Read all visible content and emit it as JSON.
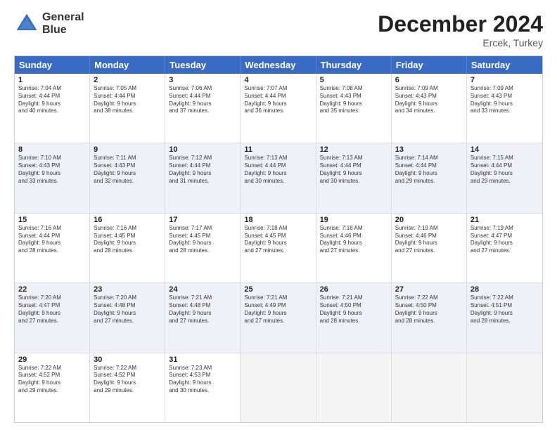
{
  "header": {
    "logo_line1": "General",
    "logo_line2": "Blue",
    "main_title": "December 2024",
    "subtitle": "Ercek, Turkey"
  },
  "weekdays": [
    "Sunday",
    "Monday",
    "Tuesday",
    "Wednesday",
    "Thursday",
    "Friday",
    "Saturday"
  ],
  "rows": [
    {
      "alt": false,
      "cells": [
        {
          "day": "1",
          "lines": [
            "Sunrise: 7:04 AM",
            "Sunset: 4:44 PM",
            "Daylight: 9 hours",
            "and 40 minutes."
          ]
        },
        {
          "day": "2",
          "lines": [
            "Sunrise: 7:05 AM",
            "Sunset: 4:44 PM",
            "Daylight: 9 hours",
            "and 38 minutes."
          ]
        },
        {
          "day": "3",
          "lines": [
            "Sunrise: 7:06 AM",
            "Sunset: 4:44 PM",
            "Daylight: 9 hours",
            "and 37 minutes."
          ]
        },
        {
          "day": "4",
          "lines": [
            "Sunrise: 7:07 AM",
            "Sunset: 4:44 PM",
            "Daylight: 9 hours",
            "and 36 minutes."
          ]
        },
        {
          "day": "5",
          "lines": [
            "Sunrise: 7:08 AM",
            "Sunset: 4:43 PM",
            "Daylight: 9 hours",
            "and 35 minutes."
          ]
        },
        {
          "day": "6",
          "lines": [
            "Sunrise: 7:09 AM",
            "Sunset: 4:43 PM",
            "Daylight: 9 hours",
            "and 34 minutes."
          ]
        },
        {
          "day": "7",
          "lines": [
            "Sunrise: 7:09 AM",
            "Sunset: 4:43 PM",
            "Daylight: 9 hours",
            "and 33 minutes."
          ]
        }
      ]
    },
    {
      "alt": true,
      "cells": [
        {
          "day": "8",
          "lines": [
            "Sunrise: 7:10 AM",
            "Sunset: 4:43 PM",
            "Daylight: 9 hours",
            "and 33 minutes."
          ]
        },
        {
          "day": "9",
          "lines": [
            "Sunrise: 7:11 AM",
            "Sunset: 4:43 PM",
            "Daylight: 9 hours",
            "and 32 minutes."
          ]
        },
        {
          "day": "10",
          "lines": [
            "Sunrise: 7:12 AM",
            "Sunset: 4:44 PM",
            "Daylight: 9 hours",
            "and 31 minutes."
          ]
        },
        {
          "day": "11",
          "lines": [
            "Sunrise: 7:13 AM",
            "Sunset: 4:44 PM",
            "Daylight: 9 hours",
            "and 30 minutes."
          ]
        },
        {
          "day": "12",
          "lines": [
            "Sunrise: 7:13 AM",
            "Sunset: 4:44 PM",
            "Daylight: 9 hours",
            "and 30 minutes."
          ]
        },
        {
          "day": "13",
          "lines": [
            "Sunrise: 7:14 AM",
            "Sunset: 4:44 PM",
            "Daylight: 9 hours",
            "and 29 minutes."
          ]
        },
        {
          "day": "14",
          "lines": [
            "Sunrise: 7:15 AM",
            "Sunset: 4:44 PM",
            "Daylight: 9 hours",
            "and 29 minutes."
          ]
        }
      ]
    },
    {
      "alt": false,
      "cells": [
        {
          "day": "15",
          "lines": [
            "Sunrise: 7:16 AM",
            "Sunset: 4:44 PM",
            "Daylight: 9 hours",
            "and 28 minutes."
          ]
        },
        {
          "day": "16",
          "lines": [
            "Sunrise: 7:16 AM",
            "Sunset: 4:45 PM",
            "Daylight: 9 hours",
            "and 28 minutes."
          ]
        },
        {
          "day": "17",
          "lines": [
            "Sunrise: 7:17 AM",
            "Sunset: 4:45 PM",
            "Daylight: 9 hours",
            "and 28 minutes."
          ]
        },
        {
          "day": "18",
          "lines": [
            "Sunrise: 7:18 AM",
            "Sunset: 4:45 PM",
            "Daylight: 9 hours",
            "and 27 minutes."
          ]
        },
        {
          "day": "19",
          "lines": [
            "Sunrise: 7:18 AM",
            "Sunset: 4:46 PM",
            "Daylight: 9 hours",
            "and 27 minutes."
          ]
        },
        {
          "day": "20",
          "lines": [
            "Sunrise: 7:19 AM",
            "Sunset: 4:46 PM",
            "Daylight: 9 hours",
            "and 27 minutes."
          ]
        },
        {
          "day": "21",
          "lines": [
            "Sunrise: 7:19 AM",
            "Sunset: 4:47 PM",
            "Daylight: 9 hours",
            "and 27 minutes."
          ]
        }
      ]
    },
    {
      "alt": true,
      "cells": [
        {
          "day": "22",
          "lines": [
            "Sunrise: 7:20 AM",
            "Sunset: 4:47 PM",
            "Daylight: 9 hours",
            "and 27 minutes."
          ]
        },
        {
          "day": "23",
          "lines": [
            "Sunrise: 7:20 AM",
            "Sunset: 4:48 PM",
            "Daylight: 9 hours",
            "and 27 minutes."
          ]
        },
        {
          "day": "24",
          "lines": [
            "Sunrise: 7:21 AM",
            "Sunset: 4:48 PM",
            "Daylight: 9 hours",
            "and 27 minutes."
          ]
        },
        {
          "day": "25",
          "lines": [
            "Sunrise: 7:21 AM",
            "Sunset: 4:49 PM",
            "Daylight: 9 hours",
            "and 27 minutes."
          ]
        },
        {
          "day": "26",
          "lines": [
            "Sunrise: 7:21 AM",
            "Sunset: 4:50 PM",
            "Daylight: 9 hours",
            "and 28 minutes."
          ]
        },
        {
          "day": "27",
          "lines": [
            "Sunrise: 7:22 AM",
            "Sunset: 4:50 PM",
            "Daylight: 9 hours",
            "and 28 minutes."
          ]
        },
        {
          "day": "28",
          "lines": [
            "Sunrise: 7:22 AM",
            "Sunset: 4:51 PM",
            "Daylight: 9 hours",
            "and 28 minutes."
          ]
        }
      ]
    },
    {
      "alt": false,
      "cells": [
        {
          "day": "29",
          "lines": [
            "Sunrise: 7:22 AM",
            "Sunset: 4:52 PM",
            "Daylight: 9 hours",
            "and 29 minutes."
          ]
        },
        {
          "day": "30",
          "lines": [
            "Sunrise: 7:22 AM",
            "Sunset: 4:52 PM",
            "Daylight: 9 hours",
            "and 29 minutes."
          ]
        },
        {
          "day": "31",
          "lines": [
            "Sunrise: 7:23 AM",
            "Sunset: 4:53 PM",
            "Daylight: 9 hours",
            "and 30 minutes."
          ]
        },
        {
          "day": "",
          "lines": []
        },
        {
          "day": "",
          "lines": []
        },
        {
          "day": "",
          "lines": []
        },
        {
          "day": "",
          "lines": []
        }
      ]
    }
  ]
}
